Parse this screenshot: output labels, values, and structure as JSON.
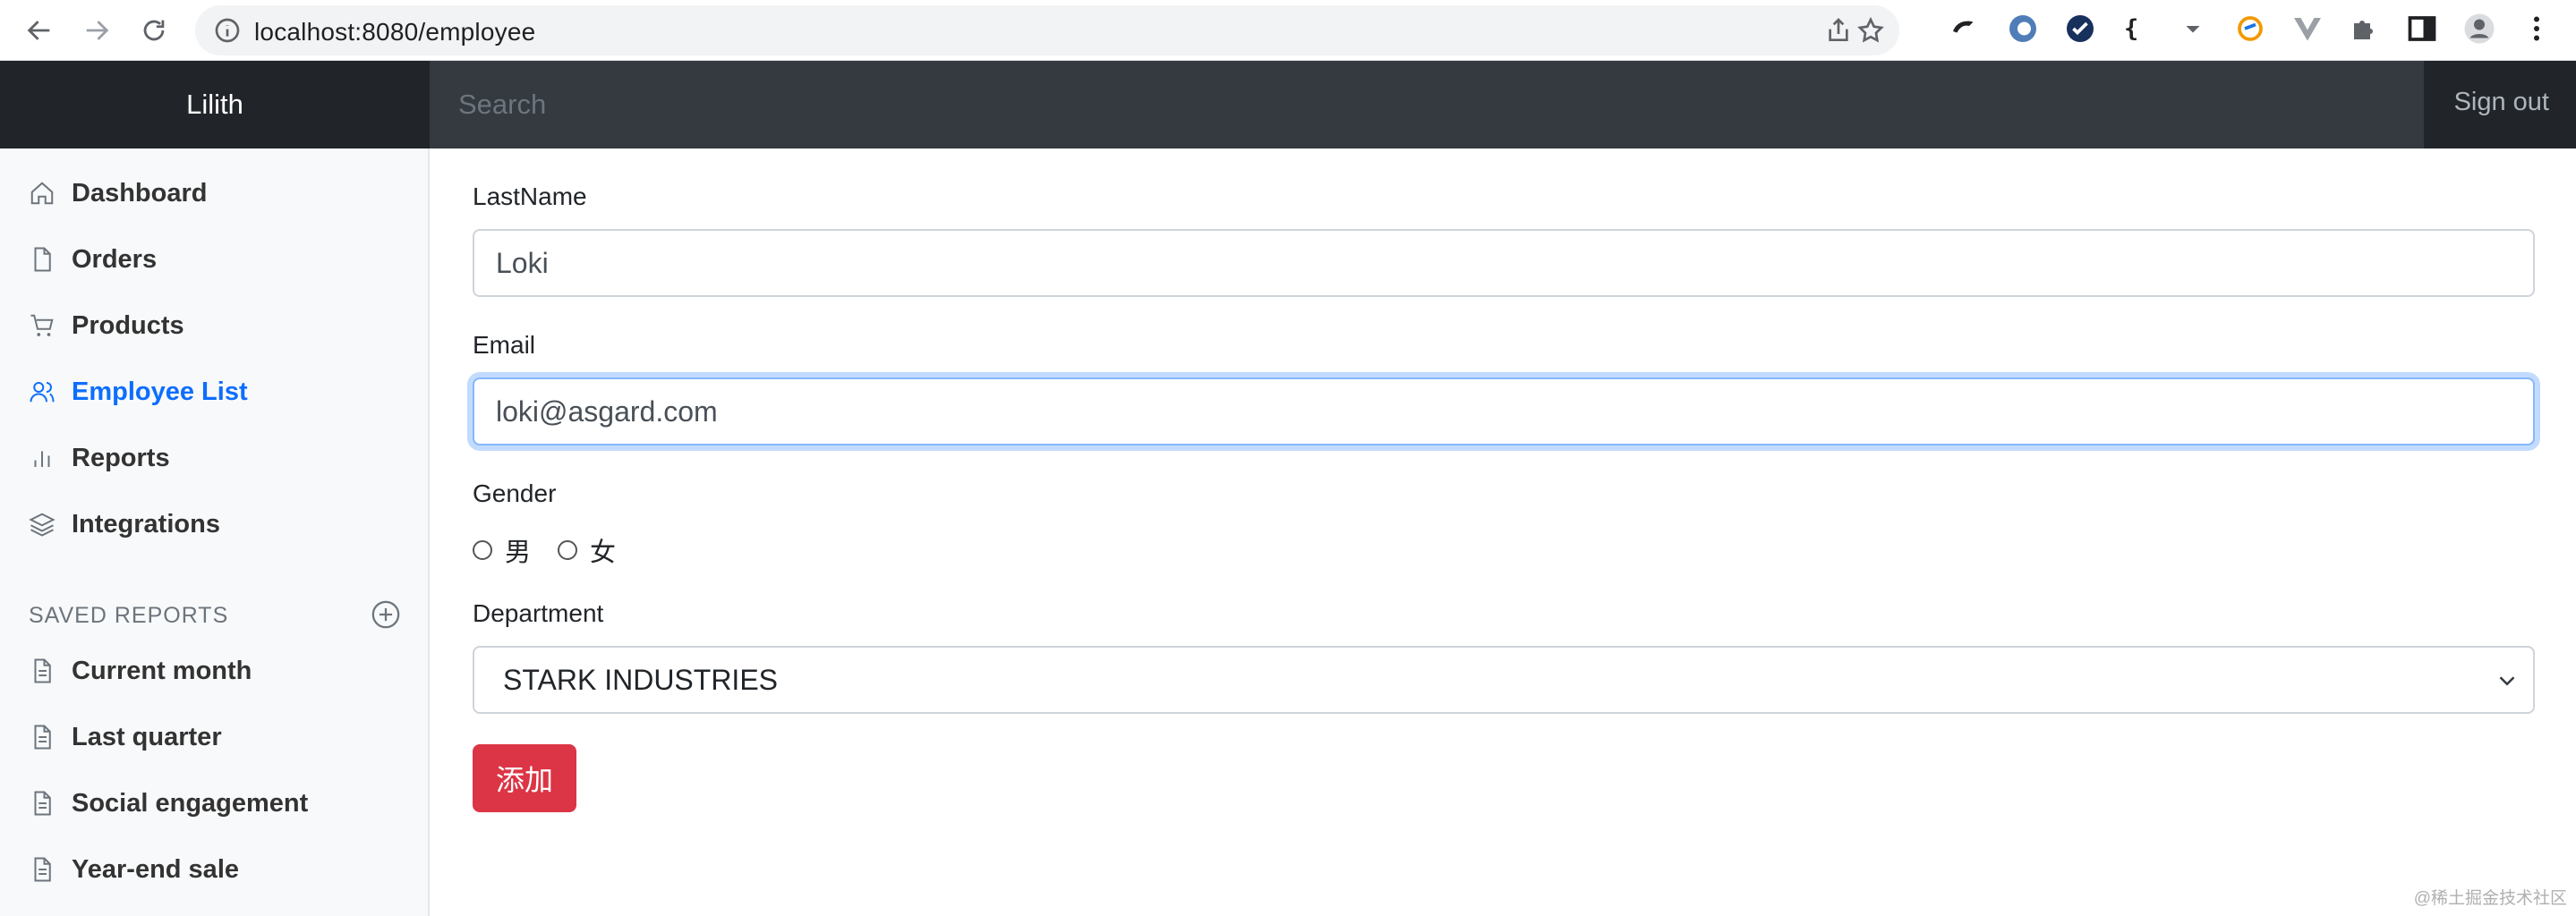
{
  "browser": {
    "url": "localhost:8080/employee",
    "icons": [
      "back-arrow-icon",
      "forward-arrow-icon",
      "reload-icon",
      "site-info-icon",
      "share-icon",
      "star-icon",
      "extension-icons",
      "puzzle-icon",
      "sidepanel-icon",
      "profile-icon",
      "kebab-menu-icon"
    ]
  },
  "navbar": {
    "brand": "Lilith",
    "search_placeholder": "Search",
    "sign_out": "Sign out"
  },
  "sidebar": {
    "items": [
      {
        "label": "Dashboard",
        "icon": "home-icon"
      },
      {
        "label": "Orders",
        "icon": "file-icon"
      },
      {
        "label": "Products",
        "icon": "cart-icon"
      },
      {
        "label": "Employee List",
        "icon": "users-icon",
        "active": true
      },
      {
        "label": "Reports",
        "icon": "bar-chart-icon"
      },
      {
        "label": "Integrations",
        "icon": "layers-icon"
      }
    ],
    "saved_heading": "SAVED REPORTS",
    "saved": [
      {
        "label": "Current month"
      },
      {
        "label": "Last quarter"
      },
      {
        "label": "Social engagement"
      },
      {
        "label": "Year-end sale"
      }
    ]
  },
  "form": {
    "lastname_label": "LastName",
    "lastname_value": "Loki",
    "email_label": "Email",
    "email_value": "loki@asgard.com",
    "gender_label": "Gender",
    "gender_options": [
      "男",
      "女"
    ],
    "department_label": "Department",
    "department_value": "STARK INDUSTRIES",
    "submit_label": "添加"
  },
  "watermark": "@稀土掘金技术社区",
  "colors": {
    "active": "#0d6efd",
    "danger": "#dc3545",
    "navbar": "#343a40",
    "brand_bg": "#212529"
  }
}
